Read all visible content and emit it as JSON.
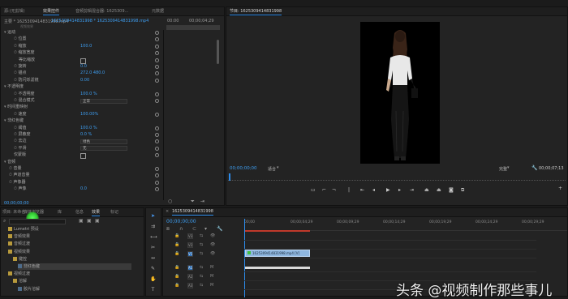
{
  "effect_controls": {
    "tabs": [
      "源:(无剪辑)",
      "效果控件",
      "音频剪辑混合器: 1625309...",
      "元数据"
    ],
    "active_tab": 1,
    "clip_source": "主要 * 1625309414831998.mp4",
    "clip_seq": "1625309414831998 * 1625309414831998.mp4",
    "time_start": "00:00",
    "time_end": "00;00;04;29",
    "video_effects_label": "视频效果",
    "rows": [
      {
        "label": "运动",
        "indent": 0
      },
      {
        "label": "位置",
        "indent": 2,
        "value": ""
      },
      {
        "label": "缩放",
        "indent": 2,
        "value": "100.0"
      },
      {
        "label": "缩放宽度",
        "indent": 2,
        "value": ""
      },
      {
        "label": "等比缩放",
        "indent": 3,
        "checkbox": true
      },
      {
        "label": "旋转",
        "indent": 2,
        "value": "0.0"
      },
      {
        "label": "锚点",
        "indent": 2,
        "value": "272.0    480.0"
      },
      {
        "label": "防闪烁滤镜",
        "indent": 2,
        "value": "0.00"
      },
      {
        "label": "不透明度",
        "indent": 0
      },
      {
        "label": "不透明度",
        "indent": 2,
        "value": "100.0 %"
      },
      {
        "label": "混合模式",
        "indent": 2,
        "select": "正常"
      },
      {
        "label": "时间重映射",
        "indent": 0
      },
      {
        "label": "速度",
        "indent": 2,
        "value": "100.00%"
      },
      {
        "label": "非红色键",
        "indent": 0
      },
      {
        "label": "阈值",
        "indent": 2,
        "value": "100.0 %"
      },
      {
        "label": "屏蔽度",
        "indent": 2,
        "value": "0.0 %"
      },
      {
        "label": "去边",
        "indent": 2,
        "select": "绿色"
      },
      {
        "label": "平滑",
        "indent": 2,
        "select": "无"
      },
      {
        "label": "仅蒙版",
        "indent": 2,
        "checkbox": true
      },
      {
        "label": "音频",
        "indent": 0
      },
      {
        "label": "音量",
        "indent": 1
      },
      {
        "label": "声道音量",
        "indent": 1
      },
      {
        "label": "声像器",
        "indent": 1
      },
      {
        "label": "声像",
        "indent": 2,
        "value": "0.0"
      }
    ],
    "footer_time": "00;00;00;00"
  },
  "program": {
    "title": "节目: 1625309414831998",
    "timecode": "00;00;00;00",
    "fit": "适合",
    "quality": "完整",
    "duration": "00;00;07;13"
  },
  "project": {
    "tabs": [
      "项目: 未命名",
      "媒体浏览器",
      "库",
      "信息",
      "效果",
      "标记"
    ],
    "active_tab": 4,
    "items": [
      {
        "label": "Lumetri 预设",
        "type": "folder",
        "indent": 1
      },
      {
        "label": "音频效果",
        "type": "folder",
        "indent": 1
      },
      {
        "label": "音频过渡",
        "type": "folder",
        "indent": 1
      },
      {
        "label": "视频效果",
        "type": "folder",
        "indent": 1
      },
      {
        "label": "键控",
        "type": "folder",
        "indent": 2
      },
      {
        "label": "非红色键",
        "type": "item",
        "indent": 3
      },
      {
        "label": "视频过渡",
        "type": "folder",
        "indent": 1
      },
      {
        "label": "溶解",
        "type": "folder",
        "indent": 2
      },
      {
        "label": "胶片溶解",
        "type": "item",
        "indent": 3
      }
    ]
  },
  "timeline": {
    "title": "1625309414831998",
    "timecode": "00;00;00;00",
    "ruler": [
      "00;00",
      "00;00;04;29",
      "00;00;09;29",
      "00;00;14;29",
      "00;00;19;29",
      "00;00;24;29",
      "00;00;29;29",
      "00;00;34;29"
    ],
    "tracks": [
      "V3",
      "V2",
      "V1",
      "A1",
      "A2",
      "A3"
    ],
    "clip_label": "1625309414831998.mp4 [V]"
  },
  "watermark": "头条 @视频制作那些事儿",
  "colors": {
    "accent": "#2d8ceb",
    "clip": "#8fb7e0",
    "playhead": "#2d8ceb",
    "folder": "#b89a3c",
    "green_cursor": "#3cd03c"
  }
}
